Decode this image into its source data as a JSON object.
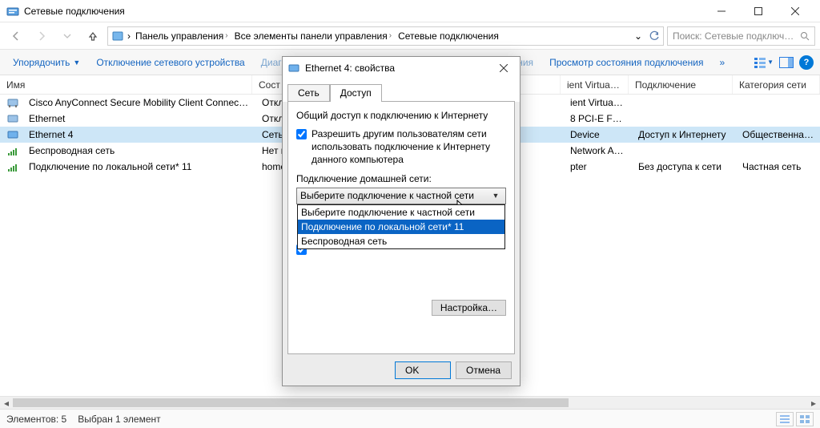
{
  "window": {
    "title": "Сетевые подключения",
    "min_tip": "Свернуть",
    "max_tip": "Развернуть",
    "close_tip": "Закрыть"
  },
  "breadcrumb": {
    "items": [
      "Панель управления",
      "Все элементы панели управления",
      "Сетевые подключения"
    ]
  },
  "search": {
    "placeholder": "Поиск: Сетевые подключения"
  },
  "toolbar": {
    "organize": "Упорядочить",
    "disable": "Отключение сетевого устройства",
    "diagnose": "Диагностика подключения",
    "rename": "Переименование подключения",
    "view_status": "Просмотр состояния подключения",
    "more": "»"
  },
  "columns": {
    "name": "Имя",
    "status": "Сост",
    "device2": "ient Virtua…",
    "connection": "Подключение",
    "category": "Категория сети"
  },
  "rows": [
    {
      "name": "Cisco AnyConnect Secure Mobility Client Connect…",
      "status": "Откл",
      "dev2": "ient Virtua…",
      "conn": "",
      "cat": ""
    },
    {
      "name": "Ethernet",
      "status": "Откл",
      "dev2": "8 PCI-E Fa…",
      "conn": "",
      "cat": ""
    },
    {
      "name": "Ethernet 4",
      "status": "Сеть",
      "dev2": "Device",
      "conn": "Доступ к Интернету",
      "cat": "Общественная сеть"
    },
    {
      "name": "Беспроводная сеть",
      "status": "Нет п",
      "dev2": "Network A…",
      "conn": "",
      "cat": ""
    },
    {
      "name": "Подключение по локальной сети* 11",
      "status": "home",
      "dev2": "pter",
      "conn": "Без доступа к сети",
      "cat": "Частная сеть"
    }
  ],
  "statusbar": {
    "elements_label": "Элементов: 5",
    "selected_label": "Выбран 1 элемент"
  },
  "dialog": {
    "title": "Ethernet 4: свойства",
    "tab_net": "Сеть",
    "tab_access": "Доступ",
    "section": "Общий доступ к подключению к Интернету",
    "chk1": "Разрешить другим пользователям сети использовать подключение к Интернету данного компьютера",
    "combo_label": "Подключение домашней сети:",
    "combo_value": "Выберите подключение к частной сети",
    "options": [
      "Выберите подключение к частной сети",
      "Подключение по локальной сети* 11",
      "Беспроводная сеть"
    ],
    "settings_btn": "Настройка…",
    "ok": "OK",
    "cancel": "Отмена"
  }
}
